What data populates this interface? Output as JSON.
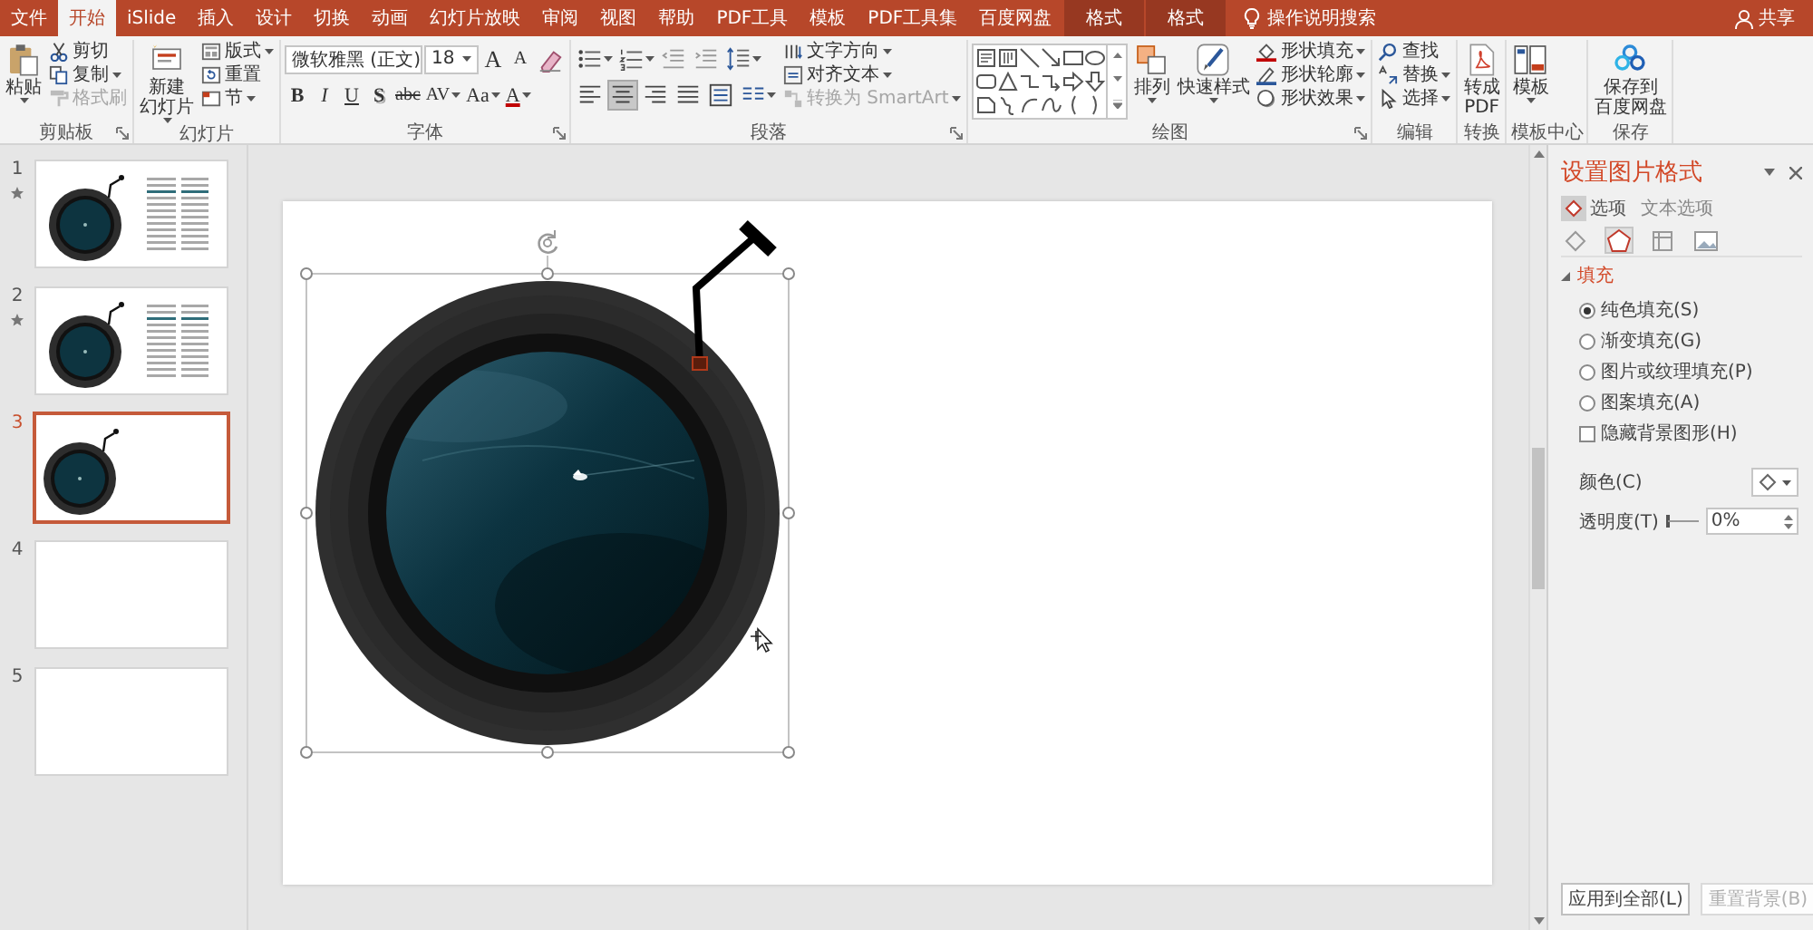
{
  "tabs": [
    {
      "label": "文件",
      "kind": "normal",
      "selected": false
    },
    {
      "label": "开始",
      "kind": "normal",
      "selected": true
    },
    {
      "label": "iSlide",
      "kind": "normal",
      "selected": false
    },
    {
      "label": "插入",
      "kind": "normal",
      "selected": false
    },
    {
      "label": "设计",
      "kind": "normal",
      "selected": false
    },
    {
      "label": "切换",
      "kind": "normal",
      "selected": false
    },
    {
      "label": "动画",
      "kind": "normal",
      "selected": false
    },
    {
      "label": "幻灯片放映",
      "kind": "normal",
      "selected": false
    },
    {
      "label": "审阅",
      "kind": "normal",
      "selected": false
    },
    {
      "label": "视图",
      "kind": "normal",
      "selected": false
    },
    {
      "label": "帮助",
      "kind": "normal",
      "selected": false
    },
    {
      "label": "PDF工具",
      "kind": "normal",
      "selected": false
    },
    {
      "label": "模板",
      "kind": "normal",
      "selected": false
    },
    {
      "label": "PDF工具集",
      "kind": "normal",
      "selected": false
    },
    {
      "label": "百度网盘",
      "kind": "normal",
      "selected": false
    },
    {
      "label": "格式",
      "kind": "context",
      "selected": false
    },
    {
      "label": "格式",
      "kind": "context",
      "selected": false
    }
  ],
  "tell_me": "操作说明搜索",
  "share": "共享",
  "ribbon": [
    {
      "label": "剪贴板",
      "launcher": true,
      "columns": [
        {
          "kind": "large",
          "lines": [
            "粘贴"
          ],
          "dropdown": true
        },
        {
          "kind": "stack",
          "items": [
            {
              "label": "剪切",
              "dropdown": false,
              "disabled": false
            },
            {
              "label": "复制",
              "dropdown": true,
              "disabled": false
            },
            {
              "label": "格式刷",
              "dropdown": false,
              "disabled": true
            }
          ]
        }
      ]
    },
    {
      "label": "幻灯片",
      "launcher": false,
      "columns": [
        {
          "kind": "large",
          "lines": [
            "新建",
            "幻灯片"
          ],
          "dropdown": true
        },
        {
          "kind": "stack",
          "items": [
            {
              "label": "版式",
              "dropdown": true,
              "disabled": false
            },
            {
              "label": "重置",
              "dropdown": false,
              "disabled": false
            },
            {
              "label": "节",
              "dropdown": true,
              "disabled": false
            }
          ]
        }
      ]
    },
    {
      "label": "字体",
      "launcher": true,
      "columns": [
        {
          "kind": "lines",
          "lines": [
            {
              "items": [
                {
                  "kind": "combo",
                  "label": "微软雅黑 (正文)"
                },
                {
                  "kind": "combo",
                  "label": "18"
                },
                {
                  "kind": "glyph",
                  "label": "A",
                  "dropdown": false
                },
                {
                  "kind": "glyph",
                  "label": "A",
                  "dropdown": false
                },
                {
                  "kind": "icon",
                  "dropdown": false
                }
              ]
            },
            {
              "items": [
                {
                  "kind": "glyph",
                  "label": "B",
                  "dropdown": false
                },
                {
                  "kind": "glyph",
                  "label": "I",
                  "dropdown": false
                },
                {
                  "kind": "glyph",
                  "label": "U",
                  "dropdown": false
                },
                {
                  "kind": "glyph",
                  "label": "S",
                  "dropdown": false
                },
                {
                  "kind": "glyph",
                  "label": "abc",
                  "dropdown": false
                },
                {
                  "kind": "glyph",
                  "label": "AV",
                  "dropdown": true
                },
                {
                  "kind": "glyph",
                  "label": "Aa",
                  "dropdown": true
                },
                {
                  "kind": "glyph",
                  "label": "A",
                  "dropdown": true
                }
              ]
            }
          ]
        }
      ]
    },
    {
      "label": "段落",
      "launcher": true,
      "columns": [
        {
          "kind": "lines",
          "lines": [
            {
              "items": [
                {
                  "kind": "icon",
                  "dropdown": true,
                  "selected": false
                },
                {
                  "kind": "icon",
                  "dropdown": true,
                  "selected": false
                },
                {
                  "kind": "icon",
                  "dropdown": false,
                  "selected": false
                },
                {
                  "kind": "icon",
                  "dropdown": false,
                  "selected": false
                },
                {
                  "kind": "icon",
                  "dropdown": true,
                  "selected": false
                }
              ]
            },
            {
              "items": [
                {
                  "kind": "icon",
                  "dropdown": false,
                  "selected": false
                },
                {
                  "kind": "icon",
                  "dropdown": false,
                  "selected": true
                },
                {
                  "kind": "icon",
                  "dropdown": false,
                  "selected": false
                },
                {
                  "kind": "icon",
                  "dropdown": false,
                  "selected": false
                },
                {
                  "kind": "icon",
                  "dropdown": false,
                  "selected": false
                },
                {
                  "kind": "icon",
                  "dropdown": true,
                  "selected": false
                }
              ]
            }
          ]
        },
        {
          "kind": "stack",
          "items": [
            {
              "label": "文字方向",
              "dropdown": true,
              "disabled": false
            },
            {
              "label": "对齐文本",
              "dropdown": true,
              "disabled": false
            },
            {
              "label": "转换为 SmartArt",
              "dropdown": true,
              "disabled": true
            }
          ]
        }
      ]
    },
    {
      "label": "绘图",
      "launcher": true,
      "columns": [
        {
          "kind": "gallery"
        },
        {
          "kind": "large",
          "lines": [
            "排列"
          ],
          "dropdown": true
        },
        {
          "kind": "large",
          "lines": [
            "快速样式"
          ],
          "dropdown": true
        },
        {
          "kind": "stack",
          "items": [
            {
              "label": "形状填充",
              "dropdown": true,
              "disabled": false
            },
            {
              "label": "形状轮廓",
              "dropdown": true,
              "disabled": false
            },
            {
              "label": "形状效果",
              "dropdown": true,
              "disabled": false
            }
          ]
        }
      ]
    },
    {
      "label": "编辑",
      "launcher": false,
      "columns": [
        {
          "kind": "stack",
          "items": [
            {
              "label": "查找",
              "dropdown": false,
              "disabled": false
            },
            {
              "label": "替换",
              "dropdown": true,
              "disabled": false
            },
            {
              "label": "选择",
              "dropdown": true,
              "disabled": false
            }
          ]
        }
      ]
    },
    {
      "label": "转换",
      "launcher": false,
      "columns": [
        {
          "kind": "large",
          "lines": [
            "转成",
            "PDF"
          ],
          "dropdown": false
        }
      ]
    },
    {
      "label": "模板中心",
      "launcher": false,
      "columns": [
        {
          "kind": "large",
          "lines": [
            "模板"
          ],
          "dropdown": true
        }
      ]
    },
    {
      "label": "保存",
      "launcher": false,
      "columns": [
        {
          "kind": "large",
          "lines": [
            "保存到",
            "百度网盘"
          ],
          "dropdown": false
        }
      ]
    }
  ],
  "slides": [
    {
      "number": "1",
      "animated": true,
      "selected": false,
      "kind": "knob_text"
    },
    {
      "number": "2",
      "animated": true,
      "selected": false,
      "kind": "knob_text"
    },
    {
      "number": "3",
      "animated": false,
      "selected": true,
      "kind": "knob"
    },
    {
      "number": "4",
      "animated": false,
      "selected": false,
      "kind": "blank"
    },
    {
      "number": "5",
      "animated": false,
      "selected": false,
      "kind": "blank"
    }
  ],
  "pane": {
    "title": "设置图片格式",
    "tabs": [
      {
        "label": "选项",
        "selected": true
      },
      {
        "label": "文本选项",
        "selected": false
      }
    ],
    "categories": [
      {
        "selected": false
      },
      {
        "selected": true
      },
      {
        "selected": false
      },
      {
        "selected": false
      }
    ],
    "section": {
      "label": "填充",
      "expanded": true
    },
    "fill_options": [
      {
        "label": "纯色填充(S)",
        "selected": true
      },
      {
        "label": "渐变填充(G)",
        "selected": false
      },
      {
        "label": "图片或纹理填充(P)",
        "selected": false
      },
      {
        "label": "图案填充(A)",
        "selected": false
      }
    ],
    "hide_background": {
      "label": "隐藏背景图形(H)",
      "checked": false
    },
    "color_label": "颜色(C)",
    "transparency": {
      "label": "透明度(T)",
      "level": 0,
      "value": "0%"
    },
    "buttons": [
      {
        "label": "应用到全部(L)",
        "disabled": false
      },
      {
        "label": "重置背景(B)",
        "disabled": true
      }
    ]
  }
}
